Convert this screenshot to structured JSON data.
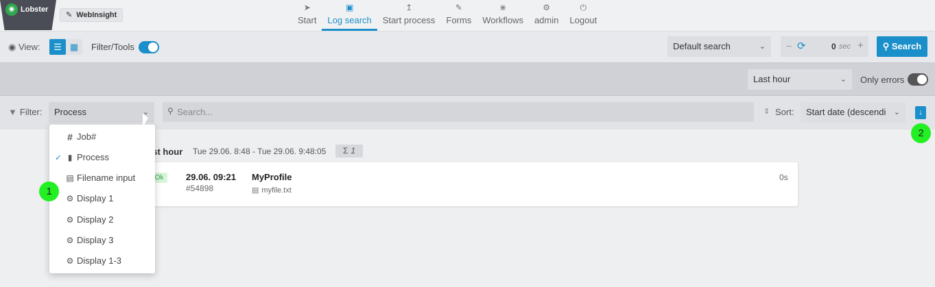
{
  "brand": {
    "name": "Lobster",
    "app": "WebInsight"
  },
  "nav": [
    {
      "label": "Start",
      "icon": "rocket-icon"
    },
    {
      "label": "Log search",
      "icon": "log-search-icon",
      "active": true
    },
    {
      "label": "Start process",
      "icon": "upload-icon"
    },
    {
      "label": "Forms",
      "icon": "edit-icon"
    },
    {
      "label": "Workflows",
      "icon": "workflow-icon"
    },
    {
      "label": "admin",
      "icon": "user-gear-icon"
    },
    {
      "label": "Logout",
      "icon": "power-icon"
    }
  ],
  "toolbar": {
    "view_label": "View:",
    "filter_tools_label": "Filter/Tools",
    "default_search": "Default search",
    "refresh_value": "0",
    "refresh_unit": "sec",
    "search_label": "Search"
  },
  "timerow": {
    "range": "Last hour",
    "only_errors_label": "Only errors"
  },
  "filter": {
    "label": "Filter:",
    "field": "Process",
    "search_placeholder": "Search...",
    "sort_label": "Sort:",
    "sort_value": "Start date (descendi"
  },
  "summary": {
    "title": "ast hour",
    "range": "Tue 29.06. 8:48 - Tue 29.06. 9:48:05",
    "count": "1"
  },
  "result": {
    "status": "Ok",
    "date": "29.06. 09:21",
    "job": "#54898",
    "profile": "MyProfile",
    "file": "myfile.txt",
    "duration": "0s"
  },
  "dropdown": [
    {
      "label": "Job#",
      "icon": "hash-icon",
      "selected": false
    },
    {
      "label": "Process",
      "icon": "process-icon",
      "selected": true
    },
    {
      "label": "Filename input",
      "icon": "file-input-icon",
      "selected": false
    },
    {
      "label": "Display 1",
      "icon": "gear-icon",
      "selected": false
    },
    {
      "label": "Display 2",
      "icon": "gear-icon",
      "selected": false
    },
    {
      "label": "Display 3",
      "icon": "gear-icon",
      "selected": false
    },
    {
      "label": "Display 1-3",
      "icon": "gears-icon",
      "selected": false
    }
  ],
  "callouts": [
    "1",
    "2"
  ],
  "colors": {
    "accent": "#1a8fc9",
    "callout": "#22f022"
  }
}
